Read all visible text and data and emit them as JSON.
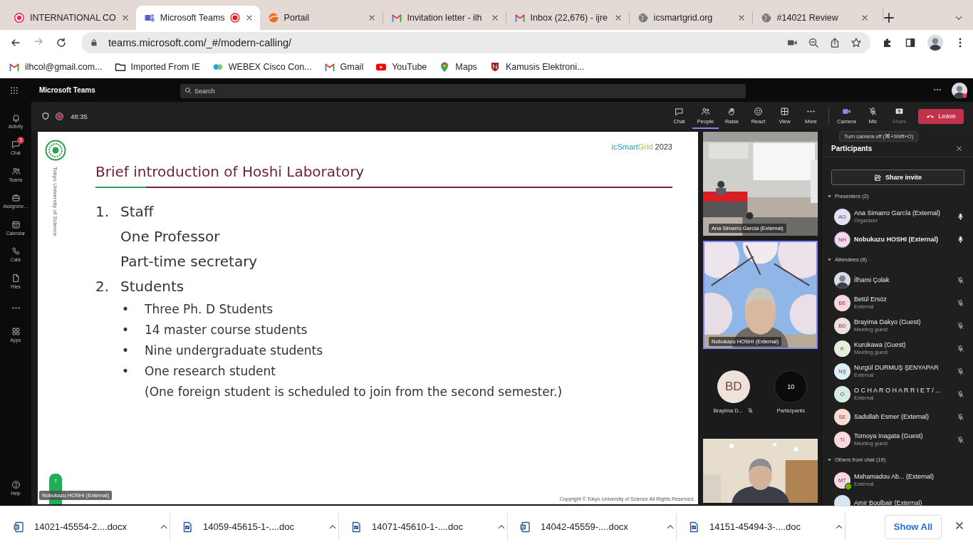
{
  "browser": {
    "tabs": [
      {
        "title": "INTERNATIONAL CO",
        "selected": false,
        "recording": false
      },
      {
        "title": "Microsoft Teams",
        "selected": true,
        "recording": true
      },
      {
        "title": "Portail",
        "selected": false,
        "recording": false
      },
      {
        "title": "Invitation letter - ilh",
        "selected": false,
        "recording": false
      },
      {
        "title": "Inbox (22,676) - ijre",
        "selected": false,
        "recording": false
      },
      {
        "title": "icsmartgrid.org",
        "selected": false,
        "recording": false
      },
      {
        "title": "#14021 Review",
        "selected": false,
        "recording": false
      }
    ],
    "url": "teams.microsoft.com/_#/modern-calling/",
    "bookmarks": [
      {
        "title": "ilhcol@gmail.com..."
      },
      {
        "title": "Imported From IE"
      },
      {
        "title": "WEBEX Cisco Con..."
      },
      {
        "title": "Gmail"
      },
      {
        "title": "YouTube"
      },
      {
        "title": "Maps"
      },
      {
        "title": "Kamusis Elektroni..."
      }
    ]
  },
  "teams": {
    "app_title": "Microsoft Teams",
    "search": {
      "placeholder": "Search"
    },
    "rail": [
      {
        "label": "Activity"
      },
      {
        "label": "Chat",
        "badge": "3"
      },
      {
        "label": "Teams"
      },
      {
        "label": "Assignme…"
      },
      {
        "label": "Calendar"
      },
      {
        "label": "Calls"
      },
      {
        "label": "Files"
      }
    ],
    "apps": "Apps",
    "help": "Help"
  },
  "meeting": {
    "recording": true,
    "duration": "48:35",
    "controls": [
      {
        "label": "Chat",
        "selected": false
      },
      {
        "label": "People",
        "selected": true
      },
      {
        "label": "Raise",
        "selected": false
      },
      {
        "label": "React",
        "selected": false
      },
      {
        "label": "View",
        "selected": false
      },
      {
        "label": "More",
        "selected": false
      }
    ],
    "device_controls": [
      {
        "label": "Camera",
        "disabled": false
      },
      {
        "label": "Mic",
        "disabled": false
      },
      {
        "label": "Share",
        "disabled": true
      }
    ],
    "leave": "Leave"
  },
  "slide": {
    "brand": [
      {
        "text": "icSmart",
        "color": "#1ba6b8"
      },
      {
        "text": "Grid",
        "color": "#a6c628"
      }
    ],
    "year": "2023",
    "university": "Tokyo University of Science",
    "title": "Brief introduction of Hoshi Laboratory",
    "outline": [
      {
        "number": "1.",
        "text": "Staff",
        "children": [
          {
            "text": "One Professor"
          },
          {
            "text": "Part-time secretary"
          }
        ]
      },
      {
        "number": "2.",
        "text": "Students",
        "children": [
          {
            "bullet": "•",
            "text": "Three Ph. D Students"
          },
          {
            "bullet": "•",
            "text": "14 master course students"
          },
          {
            "bullet": "•",
            "text": "Nine undergraduate students"
          },
          {
            "bullet": "•",
            "text": "One research student",
            "children": [
              {
                "text": "(One foreign student is scheduled to join from the second semester.)"
              }
            ]
          }
        ]
      }
    ],
    "page": "7",
    "copyright": "Copyright © Tokyo University of Science All Rights Reserved.",
    "presenter_label": "Nobukazu HOSHI (External)"
  },
  "videos": [
    {
      "label": "Ana Simarro García (External)",
      "speaking": false
    },
    {
      "label": "Nobukazu HOSHI (External)",
      "speaking": true
    }
  ],
  "gallery": {
    "avatar": {
      "initials": "BD",
      "name": "Brayima D...",
      "muted": true
    },
    "count": "10",
    "count_label": "Participants"
  },
  "panel": {
    "title": "Participants",
    "tooltip": "Turn camera off (⌘+Shift+O)",
    "share_invite": "Share invite",
    "groups": [
      {
        "title": "Presenters (2)",
        "expanded": true,
        "people": [
          {
            "kind": "initials",
            "initials": "AG",
            "color": "#e4e0f5",
            "name": "Ana Simarro García (External)",
            "subtitle": "Organizer",
            "muted": false,
            "speaking": false,
            "available": false
          },
          {
            "kind": "initials",
            "initials": "NH",
            "color": "#f4d9e8",
            "name": "Nobukazu HOSHI (External)",
            "muted": false,
            "speaking": true,
            "available": false
          }
        ]
      },
      {
        "title": "Attendees (8)",
        "expanded": true,
        "people": [
          {
            "name": "İlhami Çolak",
            "muted": true,
            "speaking": false,
            "available": false
          },
          {
            "kind": "initials",
            "initials": "BE",
            "color": "#f7d7dc",
            "name": "Betül Ersöz",
            "subtitle": "External",
            "muted": true,
            "speaking": false,
            "available": false
          },
          {
            "kind": "initials",
            "initials": "BD",
            "color": "#eee0da",
            "name": "Brayima Dakyo (Guest)",
            "subtitle": "Meeting guest",
            "muted": true,
            "speaking": false,
            "available": false
          },
          {
            "kind": "initials",
            "initials": "K",
            "color": "#e3efdb",
            "name": "Kurokawa (Guest)",
            "subtitle": "Meeting guest",
            "muted": true,
            "speaking": false,
            "available": false
          },
          {
            "kind": "initials",
            "initials": "NŞ",
            "color": "#d9f0f4",
            "name": "Nurgül DURMUŞ ŞENYAPAR",
            "subtitle": "External",
            "muted": true,
            "speaking": false,
            "available": false
          },
          {
            "kind": "initials",
            "initials": "O",
            "color": "#d6ece0",
            "name": "O C H A R O H A R R I E T / ...",
            "subtitle": "External",
            "muted": true,
            "speaking": false,
            "available": false
          },
          {
            "kind": "initials",
            "initials": "SE",
            "color": "#fadbd0",
            "name": "Sadullah Esmer (External)",
            "muted": true,
            "speaking": false,
            "available": false
          },
          {
            "kind": "initials",
            "initials": "TI",
            "color": "#f8d9dd",
            "name": "Tomoya Inagata (Guest)",
            "subtitle": "Meeting guest",
            "muted": true,
            "speaking": false,
            "available": false
          }
        ]
      },
      {
        "title": "Others from chat (19)",
        "expanded": true,
        "people": [
          {
            "kind": "initials",
            "initials": "MT",
            "color": "#f8d6e6",
            "name": "Mahamadou Ab...  (External)",
            "subtitle": "External",
            "speaking": false,
            "available": true
          },
          {
            "kind": "initials",
            "color": "#d5e6f2",
            "name": "Amir Boulbair (External)",
            "speaking": false,
            "available": false
          }
        ]
      }
    ]
  },
  "downloads": {
    "files": [
      {
        "name": "14021-45554-2....docx"
      },
      {
        "name": "14059-45615-1-....doc"
      },
      {
        "name": "14071-45610-1-....doc"
      },
      {
        "name": "14042-45559-....docx"
      },
      {
        "name": "14151-45494-3-....doc"
      }
    ],
    "show_all": "Show All"
  }
}
